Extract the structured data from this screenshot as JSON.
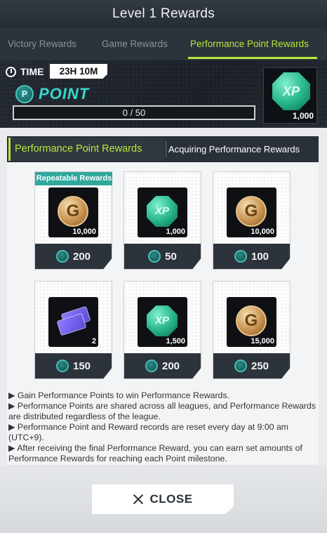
{
  "header": {
    "title": "Level 1 Rewards"
  },
  "tabs": [
    {
      "label": "Victory Rewards",
      "active": false
    },
    {
      "label": "Game Rewards",
      "active": false
    },
    {
      "label": "Performance Point Rewards",
      "active": true
    }
  ],
  "timer": {
    "label": "TIME",
    "value": "23H 10M"
  },
  "point": {
    "label": "POINT",
    "progress_text": "0 / 50",
    "progress_fraction": 0.0,
    "xp_amount": "1,000"
  },
  "subtabs": {
    "active": "Performance Point Rewards",
    "other": "Acquiring Performance Rewards"
  },
  "rewards": [
    {
      "badge": "Repeatable Rewards",
      "icon": "gold-coin-icon",
      "amount": "10,000",
      "cost": "200"
    },
    {
      "badge": "",
      "icon": "xp-token-icon",
      "amount": "1,000",
      "cost": "50"
    },
    {
      "badge": "",
      "icon": "gold-coin-icon",
      "amount": "10,000",
      "cost": "100"
    },
    {
      "badge": "",
      "icon": "player-ticket-icon",
      "amount": "2",
      "cost": "150"
    },
    {
      "badge": "",
      "icon": "xp-token-icon",
      "amount": "1,500",
      "cost": "200"
    },
    {
      "badge": "",
      "icon": "gold-coin-icon",
      "amount": "15,000",
      "cost": "250"
    }
  ],
  "notes": [
    "▶ Gain Performance Points to win Performance Rewards.",
    "▶ Performance Points are shared across all leagues, and Performance Rewards are distributed regardless of the league.",
    "▶ Performance Point and Reward records are reset every day at 9:00 am (UTC+9).",
    "▶ After receiving the final Performance Reward, you can earn set amounts of Performance Rewards for reaching each Point milestone."
  ],
  "close_label": "CLOSE",
  "colors": {
    "accent": "#b6e83b",
    "point_teal": "#37d7cc",
    "dark_panel": "#2c333b"
  }
}
